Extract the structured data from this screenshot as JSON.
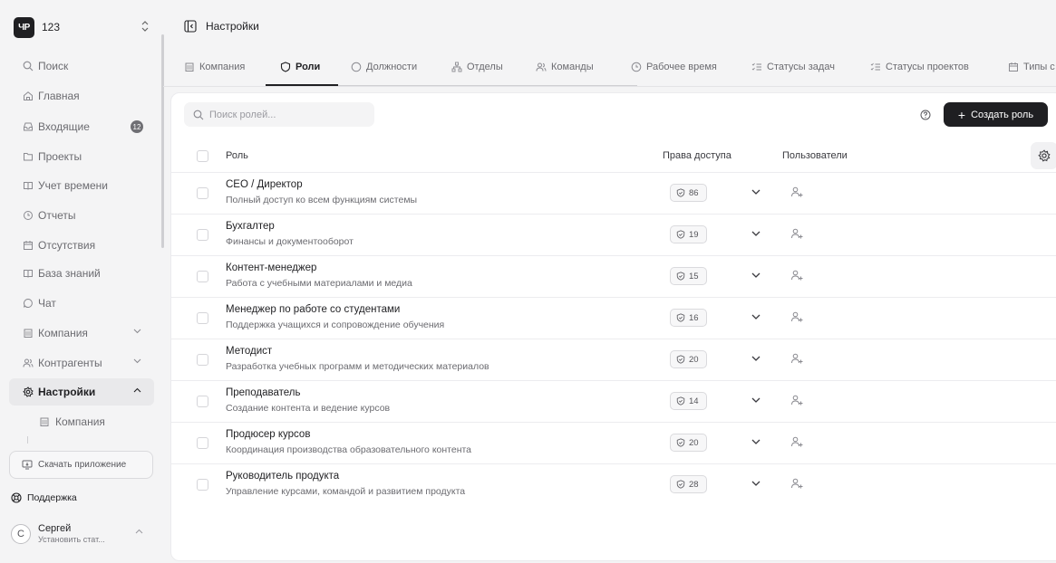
{
  "workspace": {
    "logo": "ЧР",
    "name": "123"
  },
  "sidebar": {
    "items": [
      {
        "label": "Поиск",
        "icon": "search-icon"
      },
      {
        "label": "Главная",
        "icon": "home-icon"
      },
      {
        "label": "Входящие",
        "icon": "inbox-icon",
        "badge": "12"
      },
      {
        "label": "Проекты",
        "icon": "folder-icon"
      },
      {
        "label": "Учет времени",
        "icon": "book-icon"
      },
      {
        "label": "Отчеты",
        "icon": "clock-icon"
      },
      {
        "label": "Отсутствия",
        "icon": "calendar-icon"
      },
      {
        "label": "База знаний",
        "icon": "book-icon"
      },
      {
        "label": "Чат",
        "icon": "chat-icon"
      },
      {
        "label": "Компания",
        "icon": "building-icon"
      },
      {
        "label": "Контрагенты",
        "icon": "users-icon"
      },
      {
        "label": "Настройки",
        "icon": "gear-icon",
        "active": true
      }
    ],
    "sub_items": [
      {
        "label": "Компания",
        "icon": "building-icon"
      }
    ],
    "download_label": "Скачать приложение",
    "support_label": "Поддержка",
    "user": {
      "initial": "С",
      "name": "Сергей",
      "status": "Установить стат..."
    }
  },
  "header": {
    "title": "Настройки"
  },
  "tabs": [
    {
      "label": "Компания",
      "icon": "building-icon"
    },
    {
      "label": "Роли",
      "icon": "shield-icon",
      "active": true
    },
    {
      "label": "Должности",
      "icon": "circle-icon"
    },
    {
      "label": "Отделы",
      "icon": "org-icon"
    },
    {
      "label": "Команды",
      "icon": "users-icon"
    },
    {
      "label": "Рабочее время",
      "icon": "clock-icon"
    },
    {
      "label": "Статусы задач",
      "icon": "list-check-icon"
    },
    {
      "label": "Статусы проектов",
      "icon": "list-check-icon"
    },
    {
      "label": "Типы с",
      "icon": "calendar-icon"
    }
  ],
  "toolbar": {
    "search_placeholder": "Поиск ролей...",
    "create_label": "Создать роль"
  },
  "table": {
    "columns": {
      "role": "Роль",
      "rights": "Права доступа",
      "users": "Пользователи"
    },
    "rows": [
      {
        "title": "CEO / Директор",
        "desc": "Полный доступ ко всем функциям системы",
        "perms": "86"
      },
      {
        "title": "Бухгалтер",
        "desc": "Финансы и документооборот",
        "perms": "19"
      },
      {
        "title": "Контент-менеджер",
        "desc": "Работа с учебными материалами и медиа",
        "perms": "15"
      },
      {
        "title": "Менеджер по работе со студентами",
        "desc": "Поддержка учащихся и сопровождение обучения",
        "perms": "16"
      },
      {
        "title": "Методист",
        "desc": "Разработка учебных программ и методических материалов",
        "perms": "20"
      },
      {
        "title": "Преподаватель",
        "desc": "Создание контента и ведение курсов",
        "perms": "14"
      },
      {
        "title": "Продюсер курсов",
        "desc": "Координация производства образовательного контента",
        "perms": "20"
      },
      {
        "title": "Руководитель продукта",
        "desc": "Управление курсами, командой и развитием продукта",
        "perms": "28"
      }
    ]
  }
}
